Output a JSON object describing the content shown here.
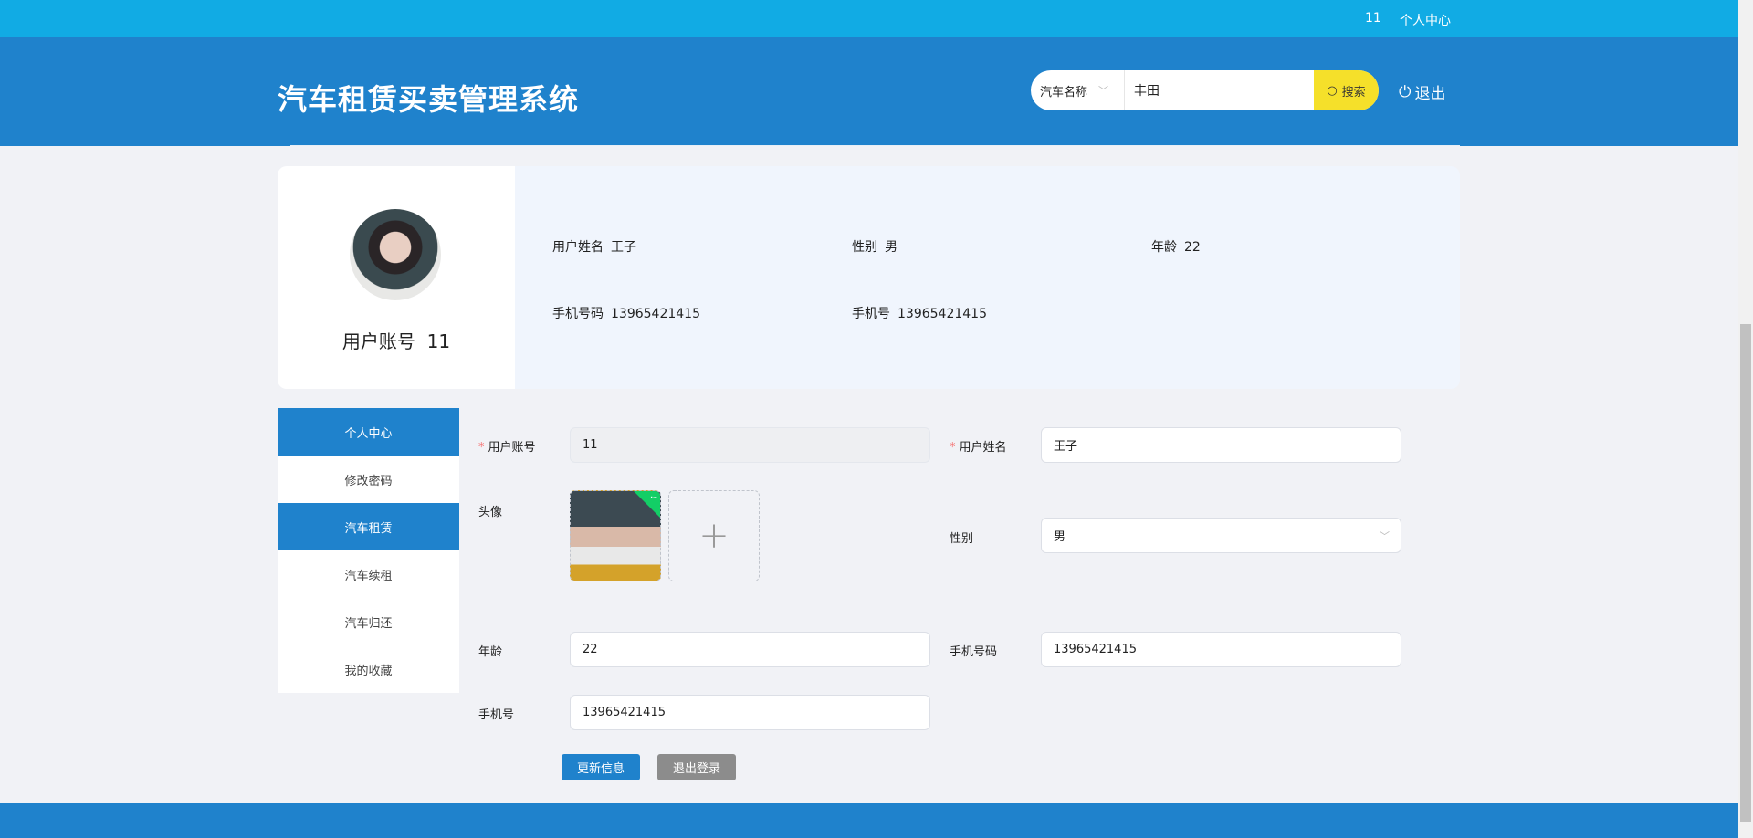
{
  "topbar": {
    "username": "11",
    "center_link": "个人中心"
  },
  "header": {
    "title": "汽车租赁买卖管理系统",
    "search": {
      "field_select": "汽车名称",
      "query": "丰田",
      "button": "搜索"
    },
    "logout": "退出"
  },
  "profile": {
    "account_label": "用户账号",
    "account": "11",
    "info": [
      {
        "label": "用户姓名",
        "value": "王子"
      },
      {
        "label": "性别",
        "value": "男"
      },
      {
        "label": "年龄",
        "value": "22"
      },
      {
        "label": "手机号码",
        "value": "13965421415"
      },
      {
        "label": "手机号",
        "value": "13965421415"
      }
    ]
  },
  "menu": [
    {
      "label": "个人中心"
    },
    {
      "label": "修改密码"
    },
    {
      "label": "汽车租赁"
    },
    {
      "label": "汽车续租"
    },
    {
      "label": "汽车归还"
    },
    {
      "label": "我的收藏"
    }
  ],
  "form": {
    "account_label": "用户账号",
    "account": "11",
    "name_label": "用户姓名",
    "name": "王子",
    "avatar_label": "头像",
    "sex_label": "性别",
    "sex": "男",
    "age_label": "年龄",
    "age": "22",
    "mobile_label": "手机号码",
    "mobile": "13965421415",
    "phone_label": "手机号",
    "phone": "13965421415",
    "update_button": "更新信息",
    "logout_button": "退出登录"
  },
  "colors": {
    "topbar": "#11abe4",
    "header": "#1f82cc",
    "search_button": "#f5e02a",
    "primary": "#1f82cc"
  }
}
